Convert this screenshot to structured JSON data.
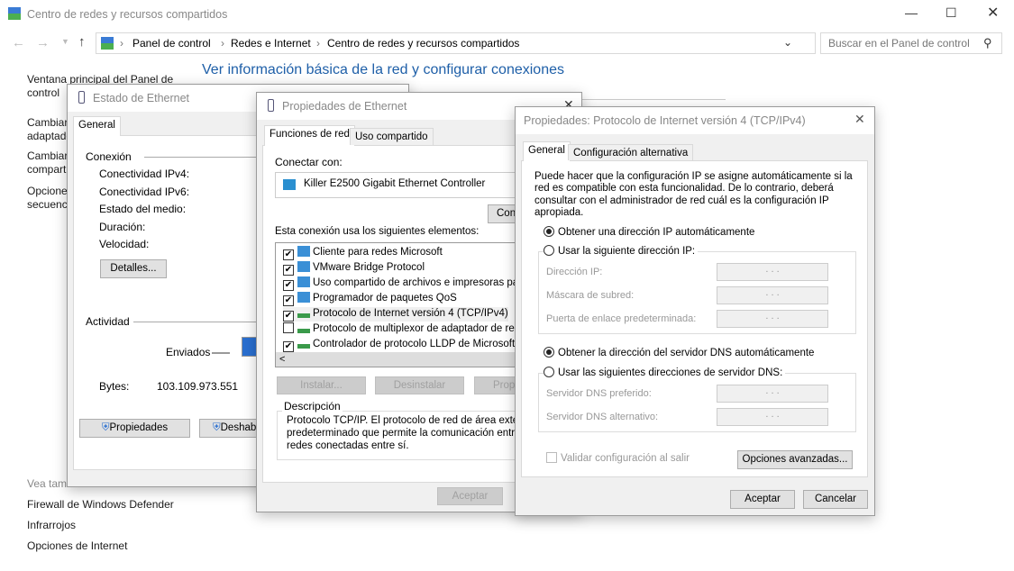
{
  "main_window": {
    "title": "Centro de redes y recursos compartidos",
    "breadcrumb": [
      "Panel de control",
      "Redes e Internet",
      "Centro de redes y recursos compartidos"
    ],
    "search_placeholder": "Buscar en el Panel de control",
    "heading": "Ver información básica de la red y configurar conexiones",
    "sidebar": {
      "items": [
        "Ventana principal del Panel de control",
        "Cambiar configuración del adaptador",
        "Cambiar configuración de uso compartido avanzado",
        "Opciones de transmisión por secuencias de multimedia"
      ],
      "see_also_label": "Vea también",
      "see_also": [
        "Firewall de Windows Defender",
        "Infrarrojos",
        "Opciones de Internet"
      ]
    }
  },
  "status_dialog": {
    "title": "Estado de Ethernet",
    "tab": "General",
    "connection_label": "Conexión",
    "fields": [
      "Conectividad IPv4:",
      "Conectividad IPv6:",
      "Estado del medio:",
      "Duración:",
      "Velocidad:"
    ],
    "details_button": "Detalles...",
    "activity_label": "Actividad",
    "sent_label": "Enviados",
    "bytes_label": "Bytes:",
    "bytes_sent": "103.109.973.551",
    "properties_button": "Propiedades",
    "disable_button": "Deshabilitar"
  },
  "props_dialog": {
    "title": "Propiedades de Ethernet",
    "tabs": [
      "Funciones de red",
      "Uso compartido"
    ],
    "connect_with": "Conectar con:",
    "adapter": "Killer E2500 Gigabit Ethernet Controller",
    "configure_button": "Configurar...",
    "items_label": "Esta conexión usa los siguientes elementos:",
    "items": [
      {
        "label": "Cliente para redes Microsoft",
        "checked": true
      },
      {
        "label": "VMware Bridge Protocol",
        "checked": true
      },
      {
        "label": "Uso compartido de archivos e impresoras para redes Microsoft",
        "checked": true
      },
      {
        "label": "Programador de paquetes QoS",
        "checked": true
      },
      {
        "label": "Protocolo de Internet versión 4 (TCP/IPv4)",
        "checked": true
      },
      {
        "label": "Protocolo de multiplexor de adaptador de red de Microsoft",
        "checked": false
      },
      {
        "label": "Controlador de protocolo LLDP de Microsoft",
        "checked": true
      }
    ],
    "install_button": "Instalar...",
    "uninstall_button": "Desinstalar",
    "properties_button": "Propiedades",
    "description_label": "Descripción",
    "description_lines": [
      "Protocolo TCP/IP. El protocolo de red de área extensa",
      "predeterminado que permite la comunicación entre varias",
      "redes conectadas entre sí."
    ],
    "ok_button": "Aceptar"
  },
  "ipv4_dialog": {
    "title": "Propiedades: Protocolo de Internet versión 4 (TCP/IPv4)",
    "tabs": [
      "General",
      "Configuración alternativa"
    ],
    "intro_lines": [
      "Puede hacer que la configuración IP se asigne automáticamente si la",
      "red es compatible con esta funcionalidad. De lo contrario, deberá",
      "consultar con el administrador de red cuál es la configuración IP",
      "apropiada."
    ],
    "radio_ip_auto": "Obtener una dirección IP automáticamente",
    "radio_ip_manual": "Usar la siguiente dirección IP:",
    "ip_fields": [
      "Dirección IP:",
      "Máscara de subred:",
      "Puerta de enlace predeterminada:"
    ],
    "radio_dns_auto": "Obtener la dirección del servidor DNS automáticamente",
    "radio_dns_manual": "Usar las siguientes direcciones de servidor DNS:",
    "dns_fields": [
      "Servidor DNS preferido:",
      "Servidor DNS alternativo:"
    ],
    "ip_placeholder": ".     .     .",
    "validate_label": "Validar configuración al salir",
    "advanced_button": "Opciones avanzadas...",
    "ok_button": "Aceptar",
    "cancel_button": "Cancelar",
    "selected": {
      "ip": "auto",
      "dns": "auto",
      "validate": false
    }
  },
  "colors": {
    "heading": "#1e5fa8",
    "accent": "#0078d7"
  }
}
